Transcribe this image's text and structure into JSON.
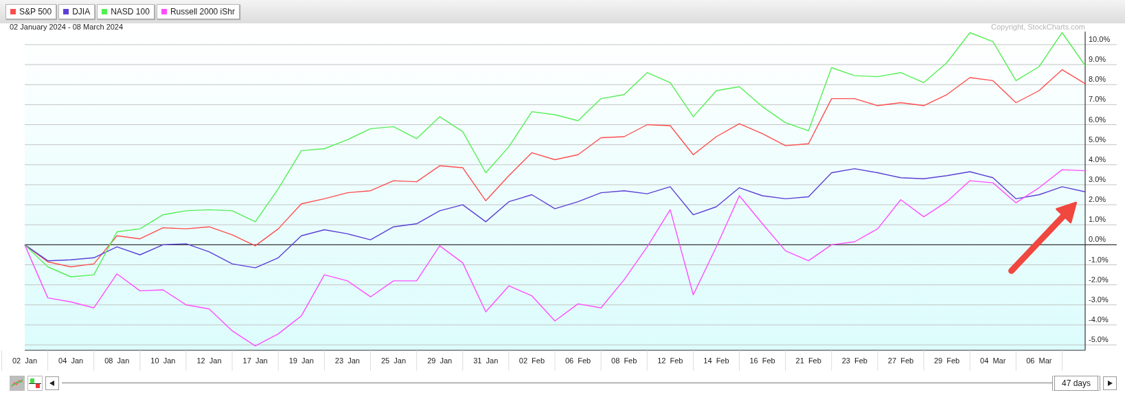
{
  "chart": {
    "date_range": "02 January 2024 - 08 March 2024",
    "copyright": "Copyright, StockCharts.com",
    "chart_data": {
      "type": "line",
      "categories": [
        "02  Jan",
        null,
        "04  Jan",
        null,
        "08  Jan",
        null,
        "10  Jan",
        null,
        "12  Jan",
        null,
        "17  Jan",
        null,
        "19  Jan",
        null,
        "23  Jan",
        null,
        "25  Jan",
        null,
        "29  Jan",
        null,
        "31  Jan",
        null,
        "02  Feb",
        null,
        "06  Feb",
        null,
        "08  Feb",
        null,
        "12  Feb",
        null,
        "14  Feb",
        null,
        "16  Feb",
        null,
        "21  Feb",
        null,
        "23  Feb",
        null,
        "27  Feb",
        null,
        "29  Feb",
        null,
        "04  Mar",
        null,
        "06  Mar",
        null,
        null
      ],
      "series": [
        {
          "name": "S&P 500",
          "color": "#ff4d4d",
          "values": [
            0,
            -0.85,
            -1.1,
            -0.95,
            0.45,
            0.3,
            0.85,
            0.8,
            0.9,
            0.5,
            -0.05,
            0.8,
            2.05,
            2.3,
            2.6,
            2.7,
            3.2,
            3.15,
            3.95,
            3.85,
            2.2,
            3.45,
            4.6,
            4.25,
            4.5,
            5.35,
            5.4,
            6.0,
            5.95,
            4.5,
            5.4,
            6.05,
            5.55,
            4.95,
            5.05,
            7.3,
            7.3,
            6.95,
            7.1,
            6.95,
            7.5,
            8.35,
            8.2,
            7.1,
            7.7,
            8.75,
            8.05
          ]
        },
        {
          "name": "DJIA",
          "color": "#5b3fd4",
          "values": [
            0,
            -0.8,
            -0.75,
            -0.65,
            -0.1,
            -0.5,
            0,
            0.05,
            -0.35,
            -0.95,
            -1.15,
            -0.65,
            0.45,
            0.75,
            0.55,
            0.25,
            0.9,
            1.05,
            1.7,
            2.0,
            1.15,
            2.15,
            2.5,
            1.8,
            2.15,
            2.6,
            2.7,
            2.55,
            2.9,
            1.5,
            1.9,
            2.85,
            2.45,
            2.3,
            2.4,
            3.6,
            3.8,
            3.6,
            3.35,
            3.3,
            3.45,
            3.65,
            3.35,
            2.3,
            2.5,
            2.9,
            2.65
          ]
        },
        {
          "name": "NASD 100",
          "color": "#55ee55",
          "values": [
            0,
            -1.1,
            -1.6,
            -1.5,
            0.65,
            0.8,
            1.5,
            1.7,
            1.75,
            1.7,
            1.15,
            2.8,
            4.7,
            4.8,
            5.25,
            5.8,
            5.9,
            5.3,
            6.4,
            5.65,
            3.6,
            4.9,
            6.65,
            6.5,
            6.2,
            7.3,
            7.5,
            8.6,
            8.1,
            6.4,
            7.7,
            7.9,
            6.9,
            6.1,
            5.7,
            8.85,
            8.45,
            8.4,
            8.6,
            8.1,
            9.1,
            10.6,
            10.15,
            8.2,
            8.9,
            10.6,
            8.95
          ]
        },
        {
          "name": "Russell 2000 iShr",
          "color": "#ff4dff",
          "values": [
            0,
            -2.65,
            -2.85,
            -3.15,
            -1.45,
            -2.3,
            -2.25,
            -3.0,
            -3.2,
            -4.3,
            -5.05,
            -4.45,
            -3.55,
            -1.5,
            -1.8,
            -2.6,
            -1.8,
            -1.8,
            -0.05,
            -0.9,
            -3.35,
            -2.05,
            -2.55,
            -3.8,
            -2.95,
            -3.15,
            -1.75,
            -0.1,
            1.75,
            -2.5,
            -0.1,
            2.45,
            1.05,
            -0.3,
            -0.8,
            0,
            0.15,
            0.8,
            2.25,
            1.4,
            2.15,
            3.2,
            3.1,
            2.1,
            2.85,
            3.75,
            3.7
          ]
        }
      ],
      "ylim": [
        -5.27,
        10.65
      ],
      "grid": true,
      "yticks": [
        {
          "value": 10,
          "label": "10.0%"
        },
        {
          "value": 9,
          "label": "9.0%"
        },
        {
          "value": 8,
          "label": "8.0%"
        },
        {
          "value": 7,
          "label": "7.0%"
        },
        {
          "value": 6,
          "label": "6.0%"
        },
        {
          "value": 5,
          "label": "5.0%"
        },
        {
          "value": 4,
          "label": "4.0%"
        },
        {
          "value": 3,
          "label": "3.0%"
        },
        {
          "value": 2,
          "label": "2.0%"
        },
        {
          "value": 1,
          "label": "1.0%"
        },
        {
          "value": 0,
          "label": "0.0%"
        },
        {
          "value": -1,
          "label": "-1.0%"
        },
        {
          "value": -2,
          "label": "-2.0%"
        },
        {
          "value": -3,
          "label": "-3.0%"
        },
        {
          "value": -4,
          "label": "-4.0%"
        },
        {
          "value": -5,
          "label": "-5.0%"
        }
      ]
    }
  },
  "view_buttons": [
    {
      "kind": "line",
      "selected": true
    },
    {
      "kind": "performance",
      "selected": false
    }
  ],
  "range_slider": {
    "label": "47 days"
  }
}
